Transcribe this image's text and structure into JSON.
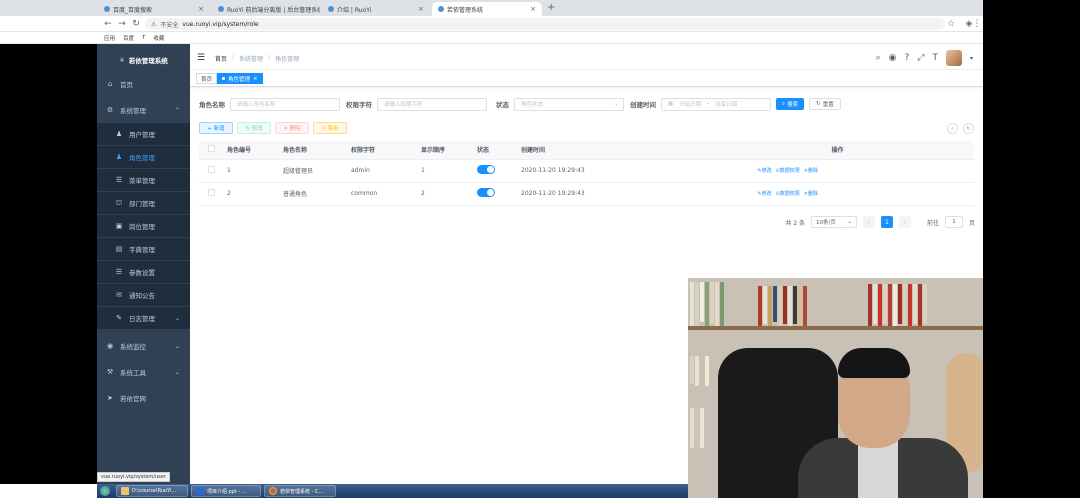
{
  "browser": {
    "tabs": [
      {
        "title": "百度_百度搜索"
      },
      {
        "title": "RuoYi 前后端分离版 | 后台管理系统"
      },
      {
        "title": "介绍 | RuoYi"
      },
      {
        "title": "若依管理系统"
      }
    ],
    "new_tab": "+",
    "address": "vue.ruoyi.vip/system/role",
    "address_prefix": "不安全",
    "bookmarks": [
      "应用",
      "百度",
      "T",
      "收藏"
    ]
  },
  "sidebar": {
    "logo_text": "若依管理系统",
    "items": [
      {
        "label": "首页",
        "icon": "⌂"
      },
      {
        "label": "系统管理",
        "icon": "⚙"
      },
      {
        "label": "用户管理",
        "icon": "♟"
      },
      {
        "label": "角色管理",
        "icon": "♟"
      },
      {
        "label": "菜单管理",
        "icon": "☰"
      },
      {
        "label": "部门管理",
        "icon": "⛫"
      },
      {
        "label": "岗位管理",
        "icon": "▣"
      },
      {
        "label": "字典管理",
        "icon": "▤"
      },
      {
        "label": "参数设置",
        "icon": "☰"
      },
      {
        "label": "通知公告",
        "icon": "✉"
      },
      {
        "label": "日志管理",
        "icon": "✎"
      },
      {
        "label": "系统监控",
        "icon": "◉"
      },
      {
        "label": "系统工具",
        "icon": "⚒"
      },
      {
        "label": "若依官网",
        "icon": "➤"
      }
    ]
  },
  "navbar": {
    "breadcrumb": [
      "首页",
      "系统管理",
      "角色管理"
    ]
  },
  "tags": {
    "home": "首页",
    "active": "角色管理"
  },
  "search": {
    "role_name_label": "角色名称",
    "role_name_placeholder": "请输入角色名称",
    "perm_label": "权限字符",
    "perm_placeholder": "请输入权限字符",
    "status_label": "状态",
    "status_placeholder": "角色状态",
    "created_label": "创建时间",
    "start_placeholder": "开始日期",
    "end_placeholder": "结束日期",
    "date_sep": "-",
    "search_btn": "搜索",
    "reset_btn": "重置"
  },
  "actions": {
    "add": "+ 新增",
    "edit": "✎ 修改",
    "delete": "✕ 删除",
    "export": "⇩ 导出"
  },
  "table": {
    "headers": [
      "角色编号",
      "角色名称",
      "权限字符",
      "显示顺序",
      "状态",
      "创建时间",
      "操作"
    ],
    "rows": [
      {
        "id": "1",
        "name": "超级管理员",
        "key": "admin",
        "order": "1",
        "status": true,
        "created": "2020-11-20 19:29:43",
        "ops": [
          "✎修改",
          "⊙数据权限",
          "✕删除"
        ]
      },
      {
        "id": "2",
        "name": "普通角色",
        "key": "common",
        "order": "2",
        "status": true,
        "created": "2020-11-20 19:29:43",
        "ops": [
          "✎修改",
          "⊙数据权限",
          "✕删除"
        ]
      }
    ]
  },
  "pagination": {
    "total": "共 2 条",
    "page_size": "10条/页",
    "current": "1",
    "goto_label": "前往",
    "goto_value": "1",
    "goto_suffix": "页"
  },
  "taskbar": {
    "items": [
      "D:\\course\\RuoYi...",
      "项目介绍.ppt - ...",
      "若依管理系统 - C..."
    ]
  },
  "status_url": "vue.ruoyi.vip/system/user",
  "colors": {
    "primary": "#1890ff",
    "sidebar": "#304156",
    "sub_menu": "#1f2d3d"
  }
}
